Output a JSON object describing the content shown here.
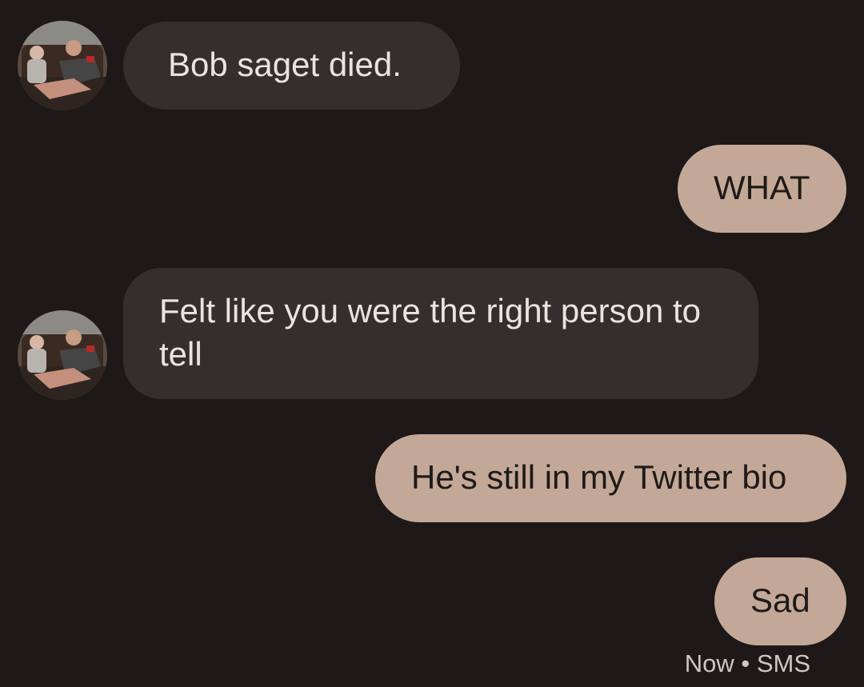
{
  "conversation": {
    "messages": [
      {
        "direction": "incoming",
        "text": "Bob saget died."
      },
      {
        "direction": "outgoing",
        "text": "WHAT"
      },
      {
        "direction": "incoming",
        "text": "Felt like you were the right person to tell"
      },
      {
        "direction": "outgoing",
        "text": "He's still in my Twitter bio"
      },
      {
        "direction": "outgoing",
        "text": "Sad"
      }
    ],
    "last_message_meta": {
      "time": "Now",
      "separator": "•",
      "channel": "SMS"
    }
  },
  "colors": {
    "background": "#1e1918",
    "incoming_bubble": "#332f2e",
    "incoming_text": "#ebe3e0",
    "outgoing_bubble": "#c3a898",
    "outgoing_text": "#1f1a18",
    "meta_text": "#cdc6c3"
  }
}
